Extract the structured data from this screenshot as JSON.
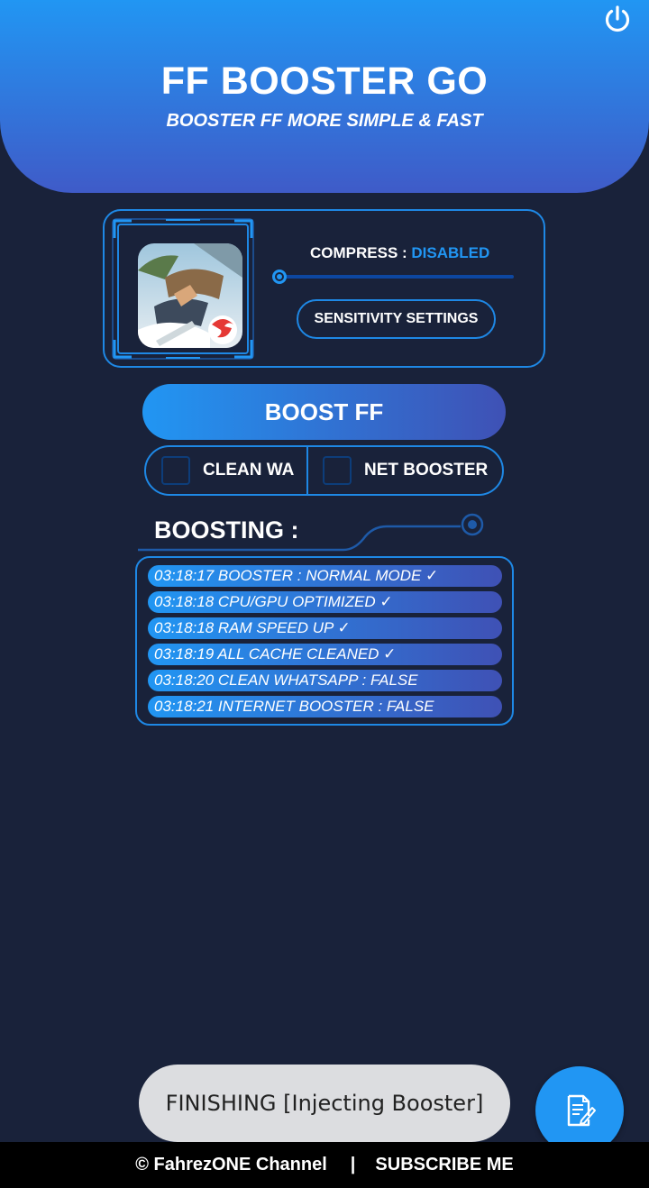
{
  "header": {
    "title": "FF BOOSTER GO",
    "subtitle": "BOOSTER FF MORE SIMPLE & FAST",
    "power_icon": "power-icon"
  },
  "game_card": {
    "icon": "free-fire-game-icon",
    "compress_label": "COMPRESS : ",
    "compress_status": "DISABLED",
    "compress_level": 0,
    "sensitivity_button": "SENSITIVITY SETTINGS"
  },
  "boost_button": "BOOST FF",
  "options": [
    {
      "label": "CLEAN WA",
      "checked": false
    },
    {
      "label": "NET BOOSTER",
      "checked": false
    }
  ],
  "boosting": {
    "title": "BOOSTING :",
    "log": [
      "03:18:17 BOOSTER : NORMAL MODE ✓",
      "03:18:18 CPU/GPU OPTIMIZED ✓",
      "03:18:18 RAM SPEED UP ✓",
      "03:18:19 ALL CACHE CLEANED ✓",
      "03:18:20 CLEAN WHATSAPP : FALSE",
      "03:18:21 INTERNET BOOSTER : FALSE"
    ]
  },
  "toast": "FINISHING [Injecting Booster]",
  "fab_icon": "notes-icon",
  "footer": {
    "credit": "© FahrezONE Channel",
    "separator": "|",
    "subscribe": "SUBSCRIBE ME"
  },
  "colors": {
    "background": "#19223a",
    "accent": "#2196f3",
    "accent_dark": "#3f51b5"
  }
}
